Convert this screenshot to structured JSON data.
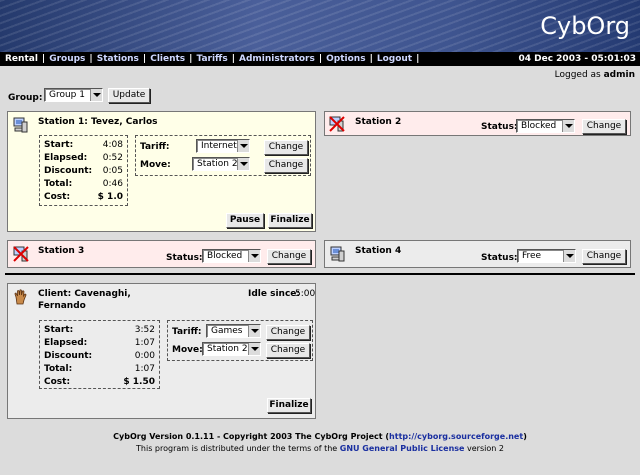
{
  "header": {
    "logo": "CybOrg"
  },
  "menu": {
    "items": [
      "Rental",
      "Groups",
      "Stations",
      "Clients",
      "Tariffs",
      "Administrators",
      "Options",
      "Logout"
    ],
    "datetime": "04 Dec 2003 - 05:01:03"
  },
  "session": {
    "logged_as_label": "Logged as",
    "user": "admin"
  },
  "group_bar": {
    "label": "Group:",
    "selected": "Group 1",
    "update_label": "Update"
  },
  "station1": {
    "title": "Station 1: Tevez, Carlos",
    "icon": "computer-icon",
    "stats": [
      {
        "label": "Start:",
        "value": "4:08"
      },
      {
        "label": "Elapsed:",
        "value": "0:52"
      },
      {
        "label": "Discount:",
        "value": "0:05"
      },
      {
        "label": "Total:",
        "value": "0:46"
      },
      {
        "label": "Cost:",
        "value": "$ 1.0"
      }
    ],
    "tariff_label": "Tariff:",
    "tariff_value": "Internet",
    "move_label": "Move:",
    "move_value": "Station 2",
    "change_label": "Change",
    "pause_label": "Pause",
    "finalize_label": "Finalize"
  },
  "station2": {
    "title": "Station 2",
    "icon": "blocked-computer-icon",
    "status_label": "Status:",
    "status_value": "Blocked",
    "change_label": "Change"
  },
  "station3": {
    "title": "Station 3",
    "icon": "blocked-computer-icon",
    "status_label": "Status:",
    "status_value": "Blocked",
    "change_label": "Change"
  },
  "station4": {
    "title": "Station 4",
    "icon": "computer-icon",
    "status_label": "Status:",
    "status_value": "Free",
    "change_label": "Change"
  },
  "client": {
    "title_line1": "Client: Cavenaghi,",
    "title_line2": "Fernando",
    "icon": "hand-icon",
    "idle_label": "Idle since:",
    "idle_value": "5:00",
    "stats": [
      {
        "label": "Start:",
        "value": "3:52"
      },
      {
        "label": "Elapsed:",
        "value": "1:07"
      },
      {
        "label": "Discount:",
        "value": "0:00"
      },
      {
        "label": "Total:",
        "value": "1:07"
      },
      {
        "label": "Cost:",
        "value": "$ 1.50"
      }
    ],
    "tariff_label": "Tariff:",
    "tariff_value": "Games",
    "move_label": "Move:",
    "move_value": "Station 2",
    "change_label": "Change",
    "finalize_label": "Finalize"
  },
  "footer": {
    "line1_prefix": "CybOrg Version 0.1.11 - Copyright 2003 The CybOrg Project (",
    "line1_link": "http://cyborg.sourceforge.net",
    "line1_suffix": ")",
    "line2_prefix": "This program is distributed under the terms of the ",
    "line2_link": "GNU General Public License",
    "line2_suffix": " version 2"
  },
  "colors": {
    "menu_bg": "#000000",
    "header_blue": "#3f5590",
    "active_station_bg": "#ffffe8",
    "blocked_station_bg": "#ffecec",
    "link": "#1a2fa0"
  }
}
